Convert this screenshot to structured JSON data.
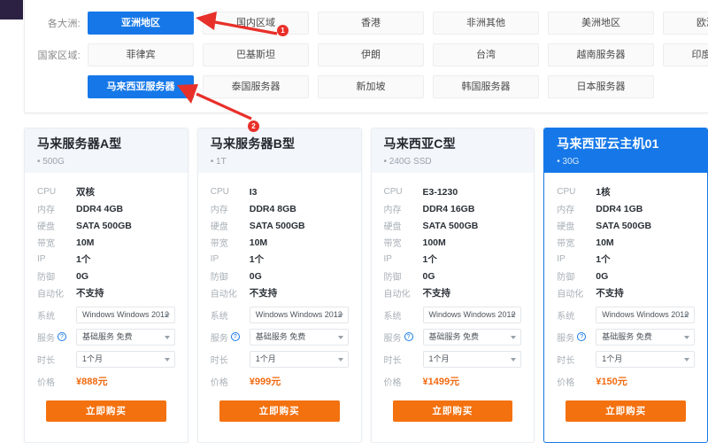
{
  "filters": [
    {
      "label": "各大洲:",
      "name": "continent",
      "options": [
        {
          "text": "亚洲地区",
          "active": true
        },
        {
          "text": "国内区域",
          "active": false
        },
        {
          "text": "香港",
          "active": false
        },
        {
          "text": "非洲其他",
          "active": false
        },
        {
          "text": "美洲地区",
          "active": false
        },
        {
          "text": "欧洲地区",
          "active": false
        }
      ]
    },
    {
      "label": "国家区域:",
      "name": "country-row-1",
      "options": [
        {
          "text": "菲律宾",
          "active": false
        },
        {
          "text": "巴基斯坦",
          "active": false
        },
        {
          "text": "伊朗",
          "active": false
        },
        {
          "text": "台湾",
          "active": false
        },
        {
          "text": "越南服务器",
          "active": false
        },
        {
          "text": "印度服务器",
          "active": false
        }
      ]
    },
    {
      "label": "",
      "name": "country-row-2",
      "options": [
        {
          "text": "马来西亚服务器",
          "active": true
        },
        {
          "text": "泰国服务器",
          "active": false
        },
        {
          "text": "新加坡",
          "active": false
        },
        {
          "text": "韩国服务器",
          "active": false
        },
        {
          "text": "日本服务器",
          "active": false
        }
      ]
    }
  ],
  "spec_labels": {
    "cpu": "CPU",
    "memory": "内存",
    "disk": "硬盘",
    "bandwidth": "带宽",
    "ip": "IP",
    "defense": "防御",
    "automation": "自动化",
    "system": "系统",
    "service": "服务",
    "duration": "时长",
    "price": "价格"
  },
  "buy_label": "立即购买",
  "cards": [
    {
      "title": "马来服务器A型",
      "sub": "500G",
      "highlight": false,
      "cpu": "双核",
      "memory": "DDR4 4GB",
      "disk": "SATA 500GB",
      "bandwidth": "10M",
      "ip": "1个",
      "defense": "0G",
      "automation": "不支持",
      "system": "Windows Windows 2012",
      "service": "基础服务 免费",
      "duration": "1个月",
      "price": "¥888元"
    },
    {
      "title": "马来服务器B型",
      "sub": "1T",
      "highlight": false,
      "cpu": "I3",
      "memory": "DDR4 8GB",
      "disk": "SATA 500GB",
      "bandwidth": "10M",
      "ip": "1个",
      "defense": "0G",
      "automation": "不支持",
      "system": "Windows Windows 2012",
      "service": "基础服务 免费",
      "duration": "1个月",
      "price": "¥999元"
    },
    {
      "title": "马来西亚C型",
      "sub": "240G SSD",
      "highlight": false,
      "cpu": "E3-1230",
      "memory": "DDR4 16GB",
      "disk": "SATA 500GB",
      "bandwidth": "100M",
      "ip": "1个",
      "defense": "0G",
      "automation": "不支持",
      "system": "Windows Windows 2012",
      "service": "基础服务 免费",
      "duration": "1个月",
      "price": "¥1499元"
    },
    {
      "title": "马来西亚云主机01",
      "sub": "30G",
      "highlight": true,
      "cpu": "1核",
      "memory": "DDR4 1GB",
      "disk": "SATA 500GB",
      "bandwidth": "10M",
      "ip": "1个",
      "defense": "0G",
      "automation": "不支持",
      "system": "Windows Windows 2012",
      "service": "基础服务 免费",
      "duration": "1个月",
      "price": "¥150元"
    }
  ],
  "annotations": [
    {
      "badge": "1"
    },
    {
      "badge": "2"
    }
  ],
  "colors": {
    "accent_blue": "#1678e8",
    "buy_orange": "#f4710f",
    "price_orange": "#f06a10",
    "annotation_red": "#e8302a",
    "corner_purple": "#2c2142"
  }
}
